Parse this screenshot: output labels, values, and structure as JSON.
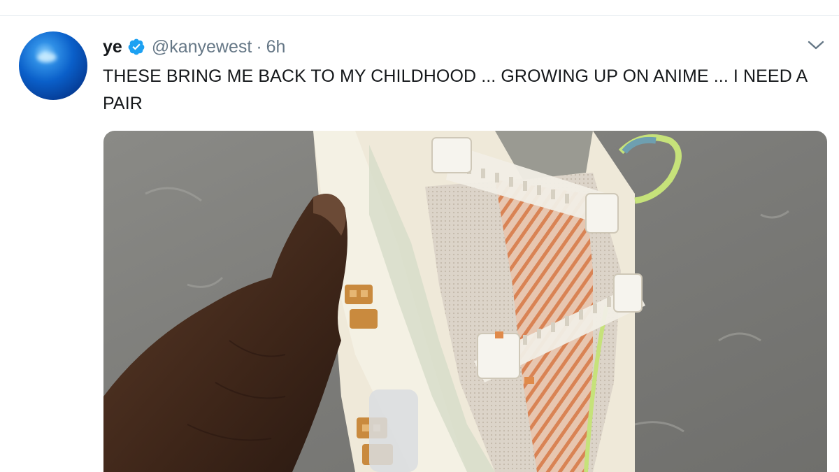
{
  "tweet": {
    "display_name": "ye",
    "handle": "@kanyewest",
    "separator": "·",
    "time": "6h",
    "text": "THESE BRING ME BACK TO MY CHILDHOOD ... GROWING UP ON ANIME ... I NEED A PAIR",
    "verified_icon": "verified-badge-icon",
    "menu_icon": "chevron-down-icon",
    "avatar": "blue-sphere-avatar",
    "media": "photo-hand-holding-sneaker"
  },
  "colors": {
    "verified_blue": "#1da1f2",
    "secondary_text": "#657786",
    "primary_text": "#14171a",
    "divider": "#e6ecf0"
  }
}
